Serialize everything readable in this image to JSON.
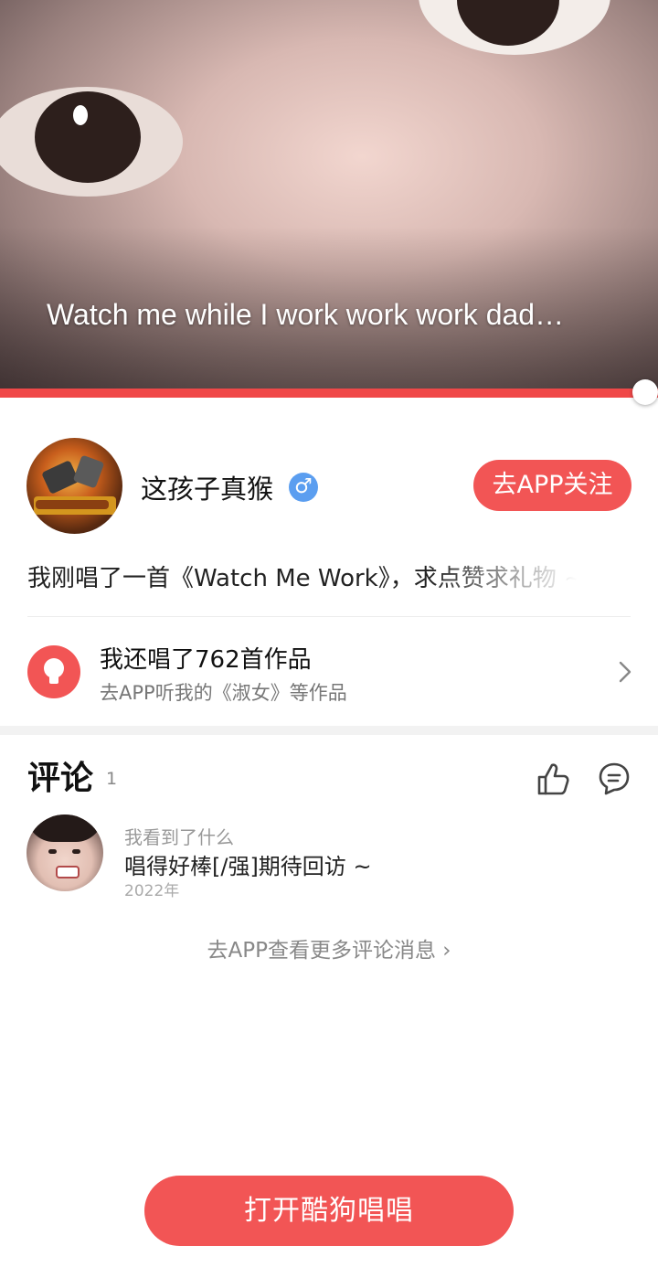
{
  "player": {
    "lyric": "Watch me while I work work work dad…",
    "progress": 0.98
  },
  "profile": {
    "name": "这孩子真猴",
    "gender_symbol": "♂",
    "follow_label": "去APP关注",
    "description": "我刚唱了一首《Watch Me Work》，求点赞求礼物 ~"
  },
  "works": {
    "title": "我还唱了762首作品",
    "subtitle": "去APP听我的《淑女》等作品",
    "icon": "lightbulb-icon"
  },
  "comments": {
    "title": "评论",
    "count": "1",
    "items": [
      {
        "user": "我看到了什么",
        "text": "唱得好棒[/强]期待回访 ~",
        "time": "2022年"
      }
    ],
    "more_label": "去APP查看更多评论消息",
    "more_chevron": "›"
  },
  "cta": {
    "open_app_label": "打开酷狗唱唱"
  },
  "colors": {
    "accent": "#f25555",
    "gender_badge": "#5b9ef0"
  }
}
